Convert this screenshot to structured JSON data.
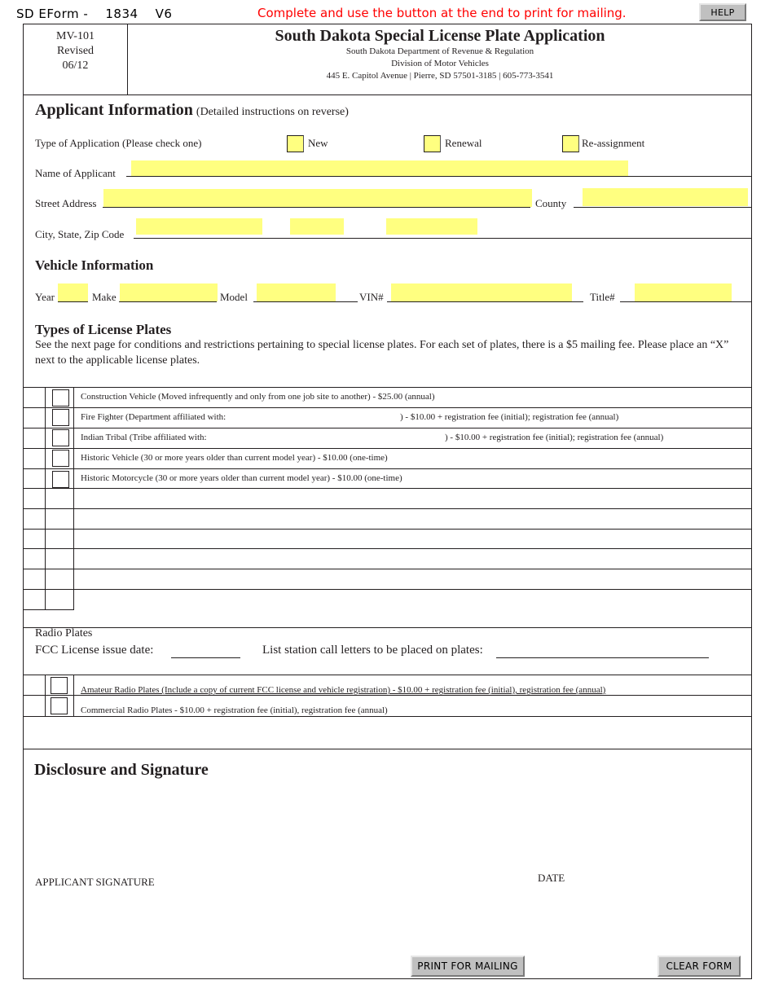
{
  "topbar": {
    "eform_id": "SD EForm -    1834    V6",
    "instruction": "Complete and use the button at the end to print for mailing.",
    "help_label": "HELP"
  },
  "header": {
    "form_number": "MV-101",
    "revised_label": "Revised",
    "revised_date": "06/12",
    "title": "South Dakota Special License Plate Application",
    "department": "South Dakota Department of Revenue & Regulation",
    "division": "Division of Motor Vehicles",
    "address": "445 E. Capitol Avenue | Pierre, SD 57501-3185 | 605-773-3541"
  },
  "applicant": {
    "heading": "Applicant Information",
    "heading_note": "(Detailed instructions on reverse)",
    "type_label": "Type of Application (Please check one)",
    "type_options": [
      {
        "label": "New",
        "checked": false
      },
      {
        "label": "Renewal",
        "checked": false
      },
      {
        "label": "Re-assignment",
        "checked": false
      }
    ],
    "name_label": "Name of Applicant",
    "name_value": "",
    "street_label": "Street Address",
    "street_value": "",
    "county_label": "County",
    "county_value": "",
    "city_label": "City, State, Zip Code",
    "city_value": "",
    "state_value": "",
    "zip_value": ""
  },
  "vehicle": {
    "heading": "Vehicle Information",
    "year_label": "Year",
    "year_value": "",
    "make_label": "Make",
    "make_value": "",
    "model_label": "Model",
    "model_value": "",
    "vin_label": "VIN#",
    "vin_value": "",
    "title_label": "Title#",
    "title_value": ""
  },
  "plates": {
    "heading": "Types of License Plates",
    "description": "See the next page for conditions and restrictions pertaining to special license plates. For each set of plates, there is a $5 mailing fee. Please place an “X” next to the applicable license plates.",
    "items": [
      {
        "text": "Construction Vehicle (Moved infrequently and only from one job site to another) - $25.00 (annual)",
        "checked": false
      },
      {
        "text": "Fire Fighter (Department affiliated with:",
        "suffix": ") - $10.00 + registration fee (initial); registration fee (annual)",
        "checked": false
      },
      {
        "text": "Indian Tribal (Tribe affiliated with:",
        "suffix": ") - $10.00 + registration fee (initial); registration fee (annual)",
        "checked": false
      },
      {
        "text": "Historic Vehicle (30 or more years older than current model year) - $10.00 (one-time)",
        "checked": false
      },
      {
        "text": "Historic Motorcycle (30 or more years older than current model year) - $10.00 (one-time)",
        "checked": false
      }
    ]
  },
  "radio": {
    "heading": "Radio Plates",
    "fcc_label": "FCC License issue date:",
    "fcc_value": "",
    "call_letters_label": "List station call letters to be placed on plates:",
    "call_letters_value": "",
    "items": [
      {
        "text": "Amateur Radio Plates (Include a copy of current FCC license and vehicle registration) - $10.00 + registration fee (initial), registration fee (annual)",
        "checked": false
      },
      {
        "text": "Commercial Radio Plates - $10.00 + registration fee (initial), registration fee (annual)",
        "checked": false
      }
    ]
  },
  "signature": {
    "heading": "Disclosure and Signature",
    "signature_label": "APPLICANT SIGNATURE",
    "date_label": "DATE"
  },
  "buttons": {
    "print_label": "PRINT FOR MAILING",
    "clear_label": "CLEAR FORM"
  },
  "colors": {
    "field_fill": "#ffff80",
    "instruction_red": "#ff0000",
    "button_gray": "#c0c0c0"
  }
}
